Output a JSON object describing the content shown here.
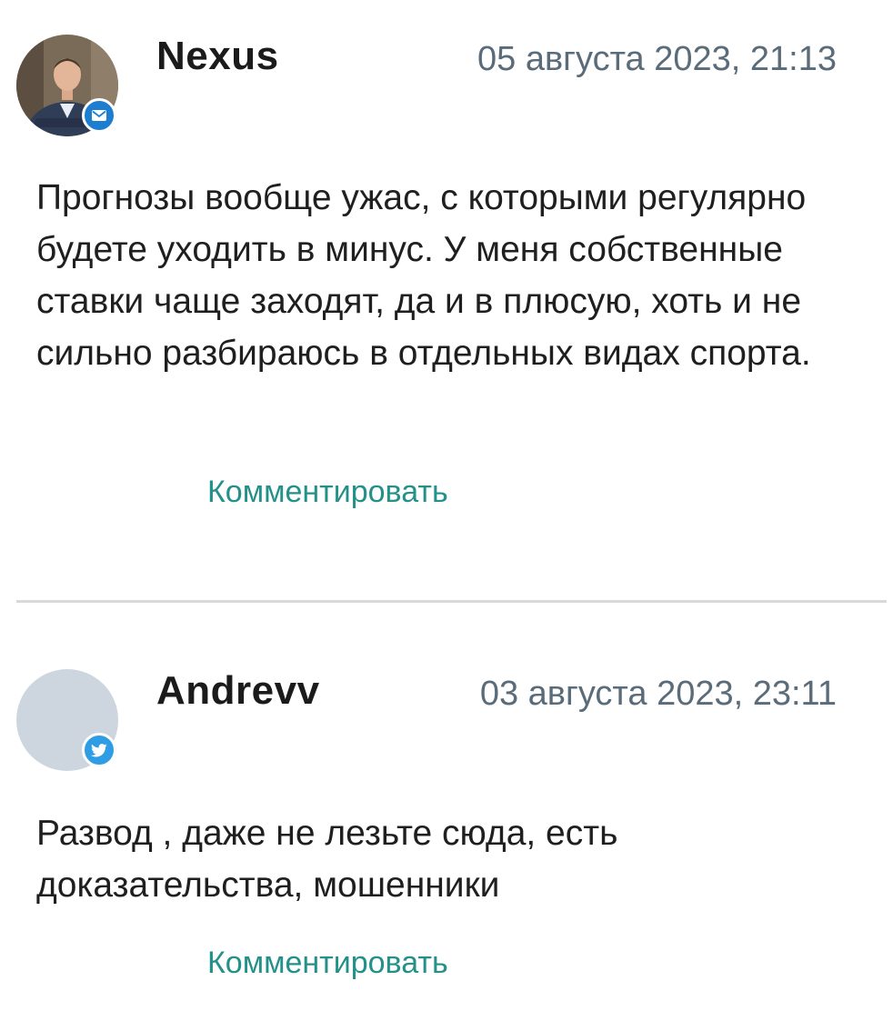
{
  "comments": [
    {
      "author": "Nexus",
      "date": "05 августа 2023, 21:13",
      "text": "Прогнозы вообще ужас, с которыми регулярно будете уходить в минус. У меня собственные ставки чаще заходят, да и в плюсую, хоть и не сильно разбираюсь в отдельных видах спорта.",
      "avatar": "user-photo",
      "badge_icon": "mail-icon",
      "reply_label": "Комментировать"
    },
    {
      "author": "Andrevv",
      "date": "03 августа 2023, 23:11",
      "text": "Развод , даже не лезьте сюда, есть доказательства, мошенники",
      "avatar": "placeholder",
      "badge_icon": "twitter-icon",
      "reply_label": "Комментировать"
    }
  ],
  "colors": {
    "author": "#1b1b1b",
    "date": "#5a6b79",
    "text": "#1f1f1f",
    "link": "#23908a",
    "divider": "#d9d9d9",
    "mail_badge": "#1d7dd0",
    "twitter_badge": "#2f9de4",
    "avatar_placeholder": "#cdd6de"
  }
}
